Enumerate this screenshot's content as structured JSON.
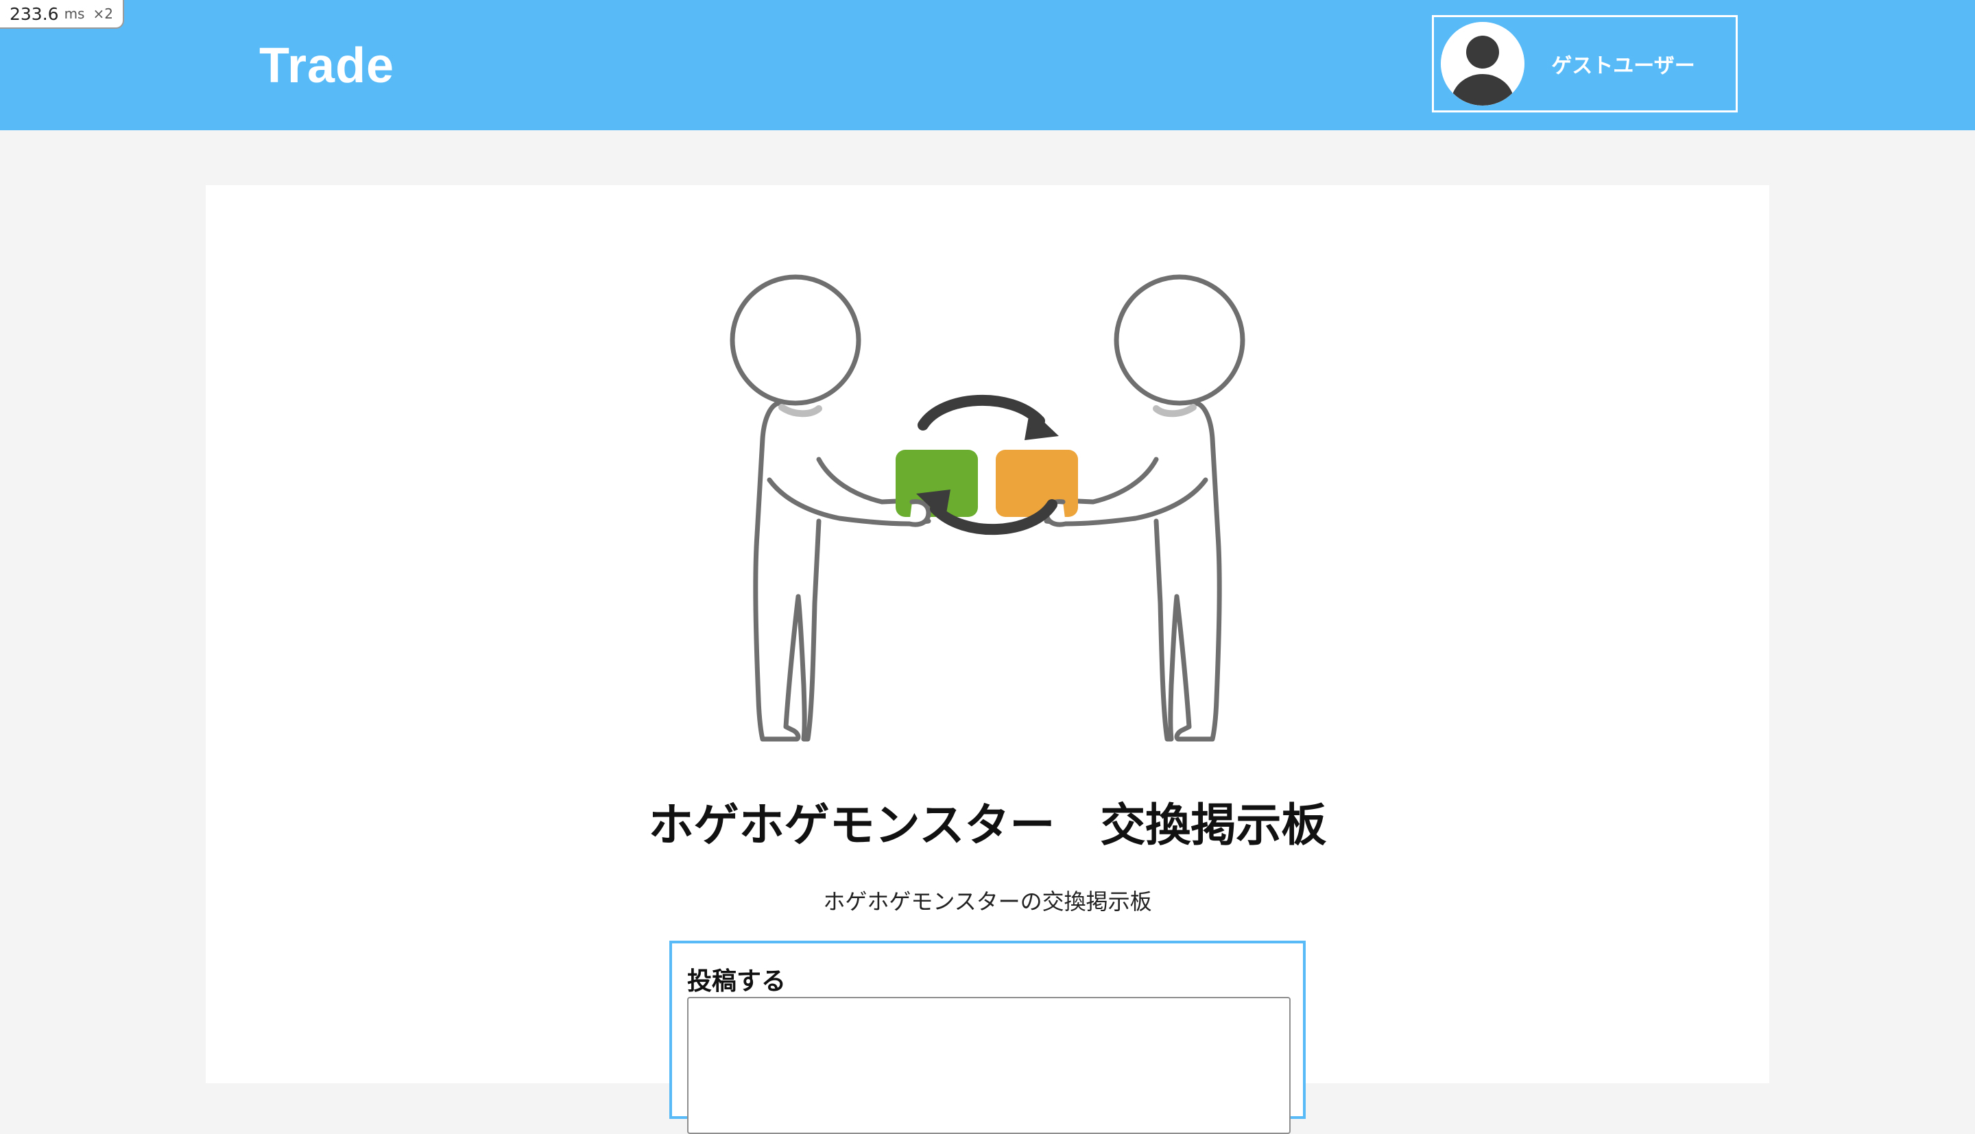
{
  "perf": {
    "value": "233.6",
    "unit": "ms",
    "multiplier": "×2"
  },
  "header": {
    "brand": "Trade",
    "user_name": "ゲストユーザー",
    "accent_color": "#58bbf8"
  },
  "board": {
    "title": "ホゲホゲモンスター　交換掲示板",
    "description": "ホゲホゲモンスターの交換掲示板"
  },
  "post_form": {
    "label": "投稿する",
    "textarea_value": ""
  },
  "icons": {
    "avatar": "person-silhouette-icon",
    "exchange": "exchange-arrows-icon"
  },
  "colors": {
    "green_card": "#6aad2f",
    "orange_card": "#eda43a",
    "background": "#f4f4f4"
  }
}
